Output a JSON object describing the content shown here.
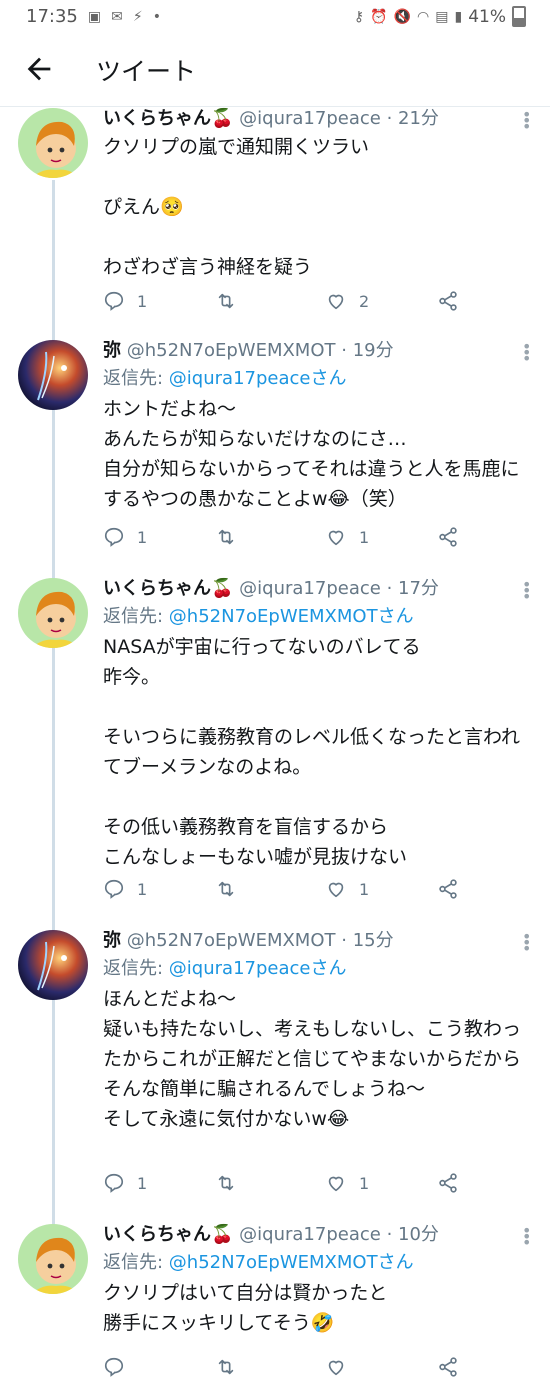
{
  "status_bar": {
    "time": "17:35",
    "battery": "41%"
  },
  "header": {
    "title": "ツイート"
  },
  "tweets": [
    {
      "name": "いくらちゃん🍒",
      "handle": "@iqura17peace",
      "time": "· 21分",
      "reply_prefix": "",
      "reply_to": "",
      "text": "クソリプの嵐で通知開くツラい\n\nぴえん🥺\n\nわざわざ言う神経を疑う",
      "replies": "1",
      "retweets": "",
      "likes": "2",
      "avatar": "cartoon-child"
    },
    {
      "name": "弥",
      "handle": "@h52N7oEpWEMXMOT",
      "time": "· 19分",
      "reply_prefix": "返信先: ",
      "reply_to": "@iqura17peaceさん",
      "text": "ホントだよね〜\nあんたらが知らないだけなのにさ…\n自分が知らないからってそれは違うと人を馬鹿にするやつの愚かなことよw😂（笑）",
      "replies": "1",
      "retweets": "",
      "likes": "1",
      "avatar": "galaxy"
    },
    {
      "name": "いくらちゃん🍒",
      "handle": "@iqura17peace",
      "time": "· 17分",
      "reply_prefix": "返信先: ",
      "reply_to": "@h52N7oEpWEMXMOTさん",
      "text": "NASAが宇宙に行ってないのバレてる\n昨今。\n\nそいつらに義務教育のレベル低くなったと言われてブーメランなのよね。\n\nその低い義務教育を盲信するから\nこんなしょーもない嘘が見抜けない",
      "replies": "1",
      "retweets": "",
      "likes": "1",
      "avatar": "cartoon-child"
    },
    {
      "name": "弥",
      "handle": "@h52N7oEpWEMXMOT",
      "time": "· 15分",
      "reply_prefix": "返信先: ",
      "reply_to": "@iqura17peaceさん",
      "text": "ほんとだよね〜\n疑いも持たないし、考えもしないし、こう教わったからこれが正解だと信じてやまないからだから\nそんな簡単に騙されるんでしょうね〜\nそして永遠に気付かないw😂",
      "replies": "1",
      "retweets": "",
      "likes": "1",
      "avatar": "galaxy"
    },
    {
      "name": "いくらちゃん🍒",
      "handle": "@iqura17peace",
      "time": "· 10分",
      "reply_prefix": "返信先: ",
      "reply_to": "@h52N7oEpWEMXMOTさん",
      "text": "クソリプはいて自分は賢かったと\n勝手にスッキリしてそう🤣",
      "replies": "",
      "retweets": "",
      "likes": "",
      "avatar": "cartoon-child"
    }
  ]
}
